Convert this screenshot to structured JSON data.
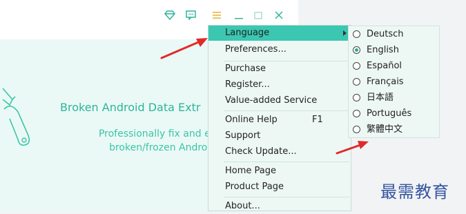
{
  "app": {
    "title": "Broken Android Data Extr",
    "desc_line1": "Professionally fix and extract fi",
    "desc_line2": "broken/frozen Android pho"
  },
  "menu": {
    "items": [
      {
        "label": "Language",
        "submenu": true,
        "highlighted": true
      },
      {
        "label": "Preferences..."
      },
      {
        "label": "Purchase"
      },
      {
        "label": "Register..."
      },
      {
        "label": "Value-added Service"
      },
      {
        "label": "Online Help",
        "shortcut": "F1"
      },
      {
        "label": "Support"
      },
      {
        "label": "Check Update..."
      },
      {
        "label": "Home Page"
      },
      {
        "label": "Product Page"
      },
      {
        "label": "About..."
      }
    ]
  },
  "languages": [
    {
      "label": "Deutsch",
      "selected": false
    },
    {
      "label": "English",
      "selected": true
    },
    {
      "label": "Español",
      "selected": false
    },
    {
      "label": "Français",
      "selected": false
    },
    {
      "label": "日本語",
      "selected": false
    },
    {
      "label": "Português",
      "selected": false
    },
    {
      "label": "繁體中文",
      "selected": false
    }
  ],
  "watermark": "最需教育",
  "icons": {
    "controls": [
      "diamond-icon",
      "feedback-icon",
      "menu-icon",
      "minimize-icon",
      "maximize-icon",
      "close-icon"
    ]
  },
  "colors": {
    "accent": "#3bc7b1",
    "app_text": "#2fb49b",
    "annotation_arrow": "#e02a2a"
  }
}
